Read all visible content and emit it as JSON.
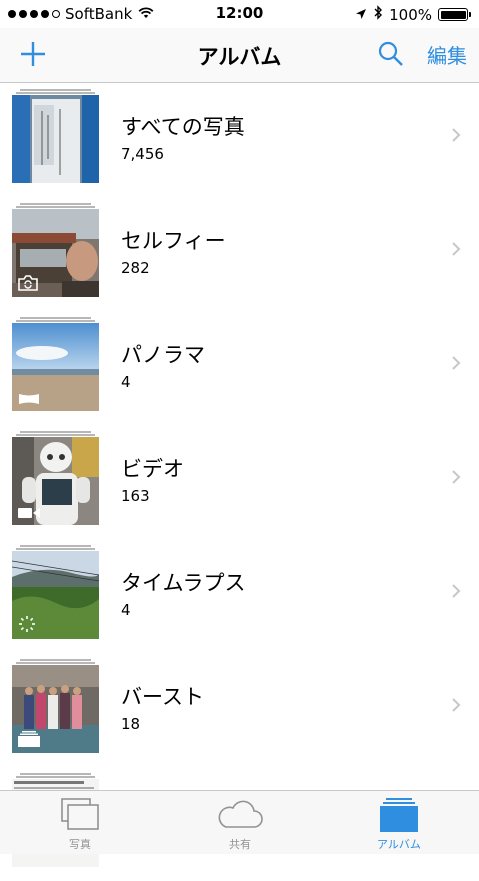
{
  "status_bar": {
    "carrier": "SoftBank",
    "time": "12:00",
    "battery": "100%",
    "battery_level": 1.0,
    "signal_bars_filled": 4,
    "signal_bars_total": 5
  },
  "nav": {
    "title": "アルバム",
    "edit_label": "編集",
    "add_icon": "plus-icon",
    "search_icon": "search-icon",
    "accent_color": "#2f8ee0"
  },
  "albums": [
    {
      "name": "すべての写真",
      "count": "7,456",
      "badge": "none"
    },
    {
      "name": "セルフィー",
      "count": "282",
      "badge": "selfie-camera-icon"
    },
    {
      "name": "パノラマ",
      "count": "4",
      "badge": "panorama-icon"
    },
    {
      "name": "ビデオ",
      "count": "163",
      "badge": "video-camera-icon"
    },
    {
      "name": "タイムラプス",
      "count": "4",
      "badge": "timelapse-icon"
    },
    {
      "name": "バースト",
      "count": "18",
      "badge": "burst-icon"
    }
  ],
  "tabs": [
    {
      "label": "写真",
      "icon": "photos-icon",
      "active": false
    },
    {
      "label": "共有",
      "icon": "cloud-icon",
      "active": false
    },
    {
      "label": "アルバム",
      "icon": "albums-icon",
      "active": true
    }
  ]
}
